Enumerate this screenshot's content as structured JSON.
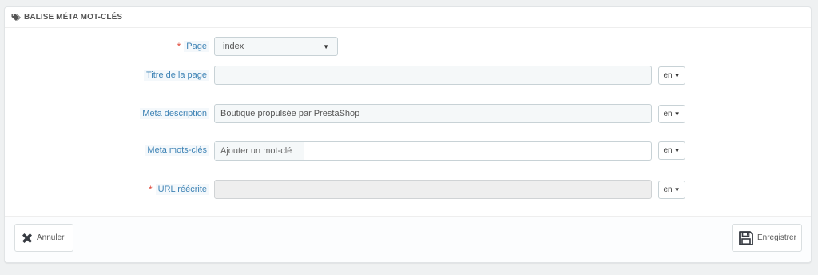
{
  "panel": {
    "title": "BALISE MÉTA MOT-CLÉS",
    "title_icon": "tags-icon"
  },
  "fields": {
    "page": {
      "label": "Page",
      "required": "*",
      "value": "index"
    },
    "page_title": {
      "label": "Titre de la page",
      "value": "",
      "lang": "en"
    },
    "meta_description": {
      "label": "Meta description",
      "value": "Boutique propulsée par PrestaShop",
      "lang": "en"
    },
    "meta_keywords": {
      "label": "Meta mots-clés",
      "placeholder": "Ajouter un mot-clé",
      "lang": "en"
    },
    "rewritten_url": {
      "label": "URL réécrite",
      "required": "*",
      "value": "",
      "lang": "en"
    }
  },
  "footer": {
    "cancel_label": "Annuler",
    "save_label": "Enregistrer"
  },
  "colors": {
    "label_blue": "#3e83b5",
    "required_red": "#e04b3c",
    "background": "#eff1f2"
  }
}
